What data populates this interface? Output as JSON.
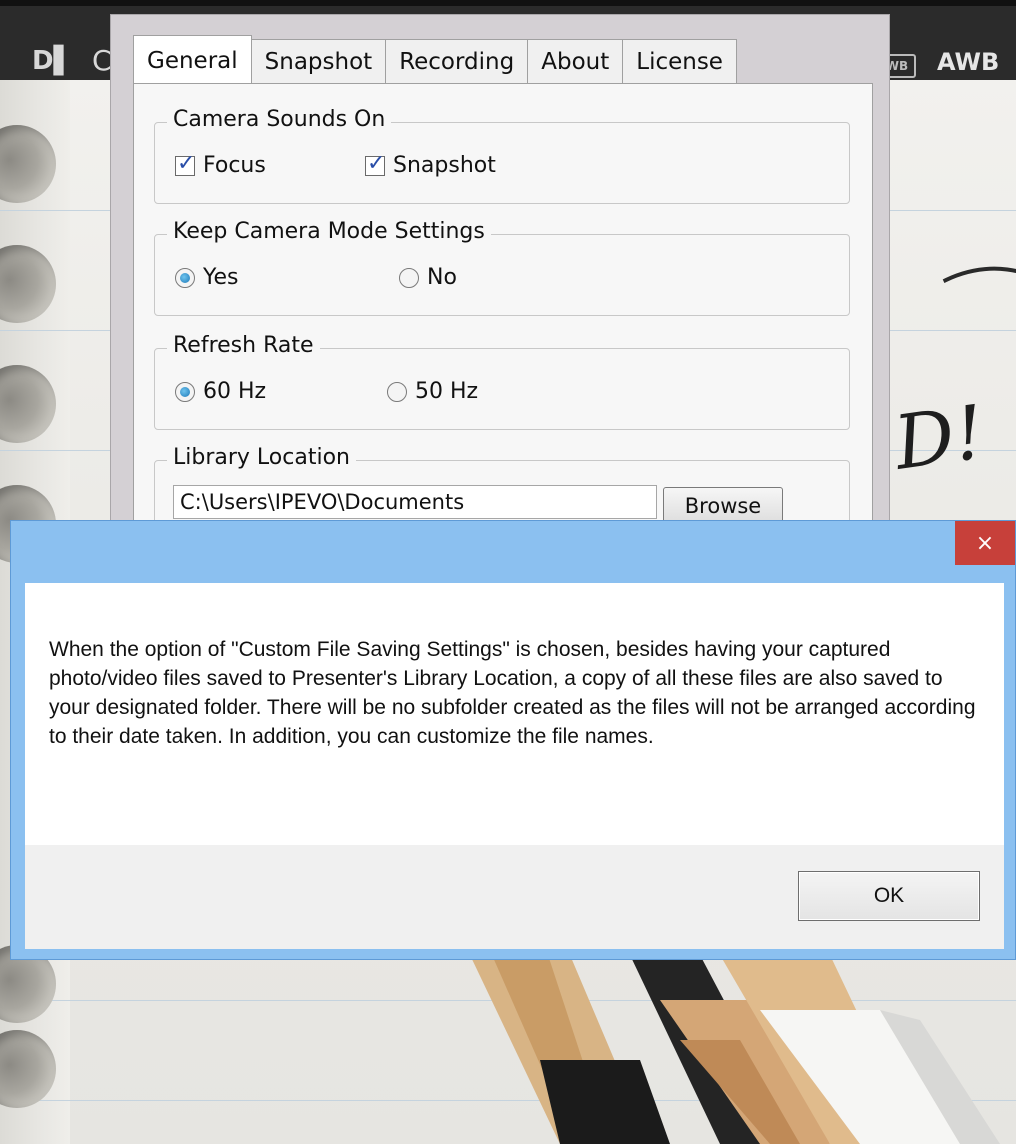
{
  "toolbar": {
    "left_icon_glyph": "D▌",
    "left_partial_label": "C",
    "wb_badge": "WB",
    "awb_label": "AWB"
  },
  "background": {
    "doodle_text": "D!"
  },
  "settings": {
    "tabs": [
      {
        "label": "General",
        "active": true
      },
      {
        "label": "Snapshot",
        "active": false
      },
      {
        "label": "Recording",
        "active": false
      },
      {
        "label": "About",
        "active": false
      },
      {
        "label": "License",
        "active": false
      }
    ],
    "camera_sounds": {
      "title": "Camera Sounds On",
      "focus": {
        "label": "Focus",
        "checked": true
      },
      "snapshot": {
        "label": "Snapshot",
        "checked": true
      }
    },
    "keep_mode": {
      "title": "Keep Camera Mode Settings",
      "yes": {
        "label": "Yes",
        "selected": true
      },
      "no": {
        "label": "No",
        "selected": false
      }
    },
    "refresh_rate": {
      "title": "Refresh Rate",
      "hz60": {
        "label": "60 Hz",
        "selected": true
      },
      "hz50": {
        "label": "50 Hz",
        "selected": false
      }
    },
    "library": {
      "title": "Library Location",
      "path": "C:\\Users\\IPEVO\\Documents",
      "browse_label": "Browse"
    }
  },
  "dialog": {
    "close_glyph": "×",
    "message": "When the option of \"Custom File Saving Settings\" is chosen, besides having your captured photo/video files saved to Presenter's Library Location, a copy of all these files are also saved to your designated folder. There will be no subfolder created as the files will not be arranged according to their date taken. In addition, you can customize the file names.",
    "ok_label": "OK"
  },
  "colors": {
    "dialog_frame": "#8bc0f0",
    "close_button": "#c7403a",
    "radio_selected": "#1c78b8",
    "check_mark": "#2a4ea8"
  }
}
